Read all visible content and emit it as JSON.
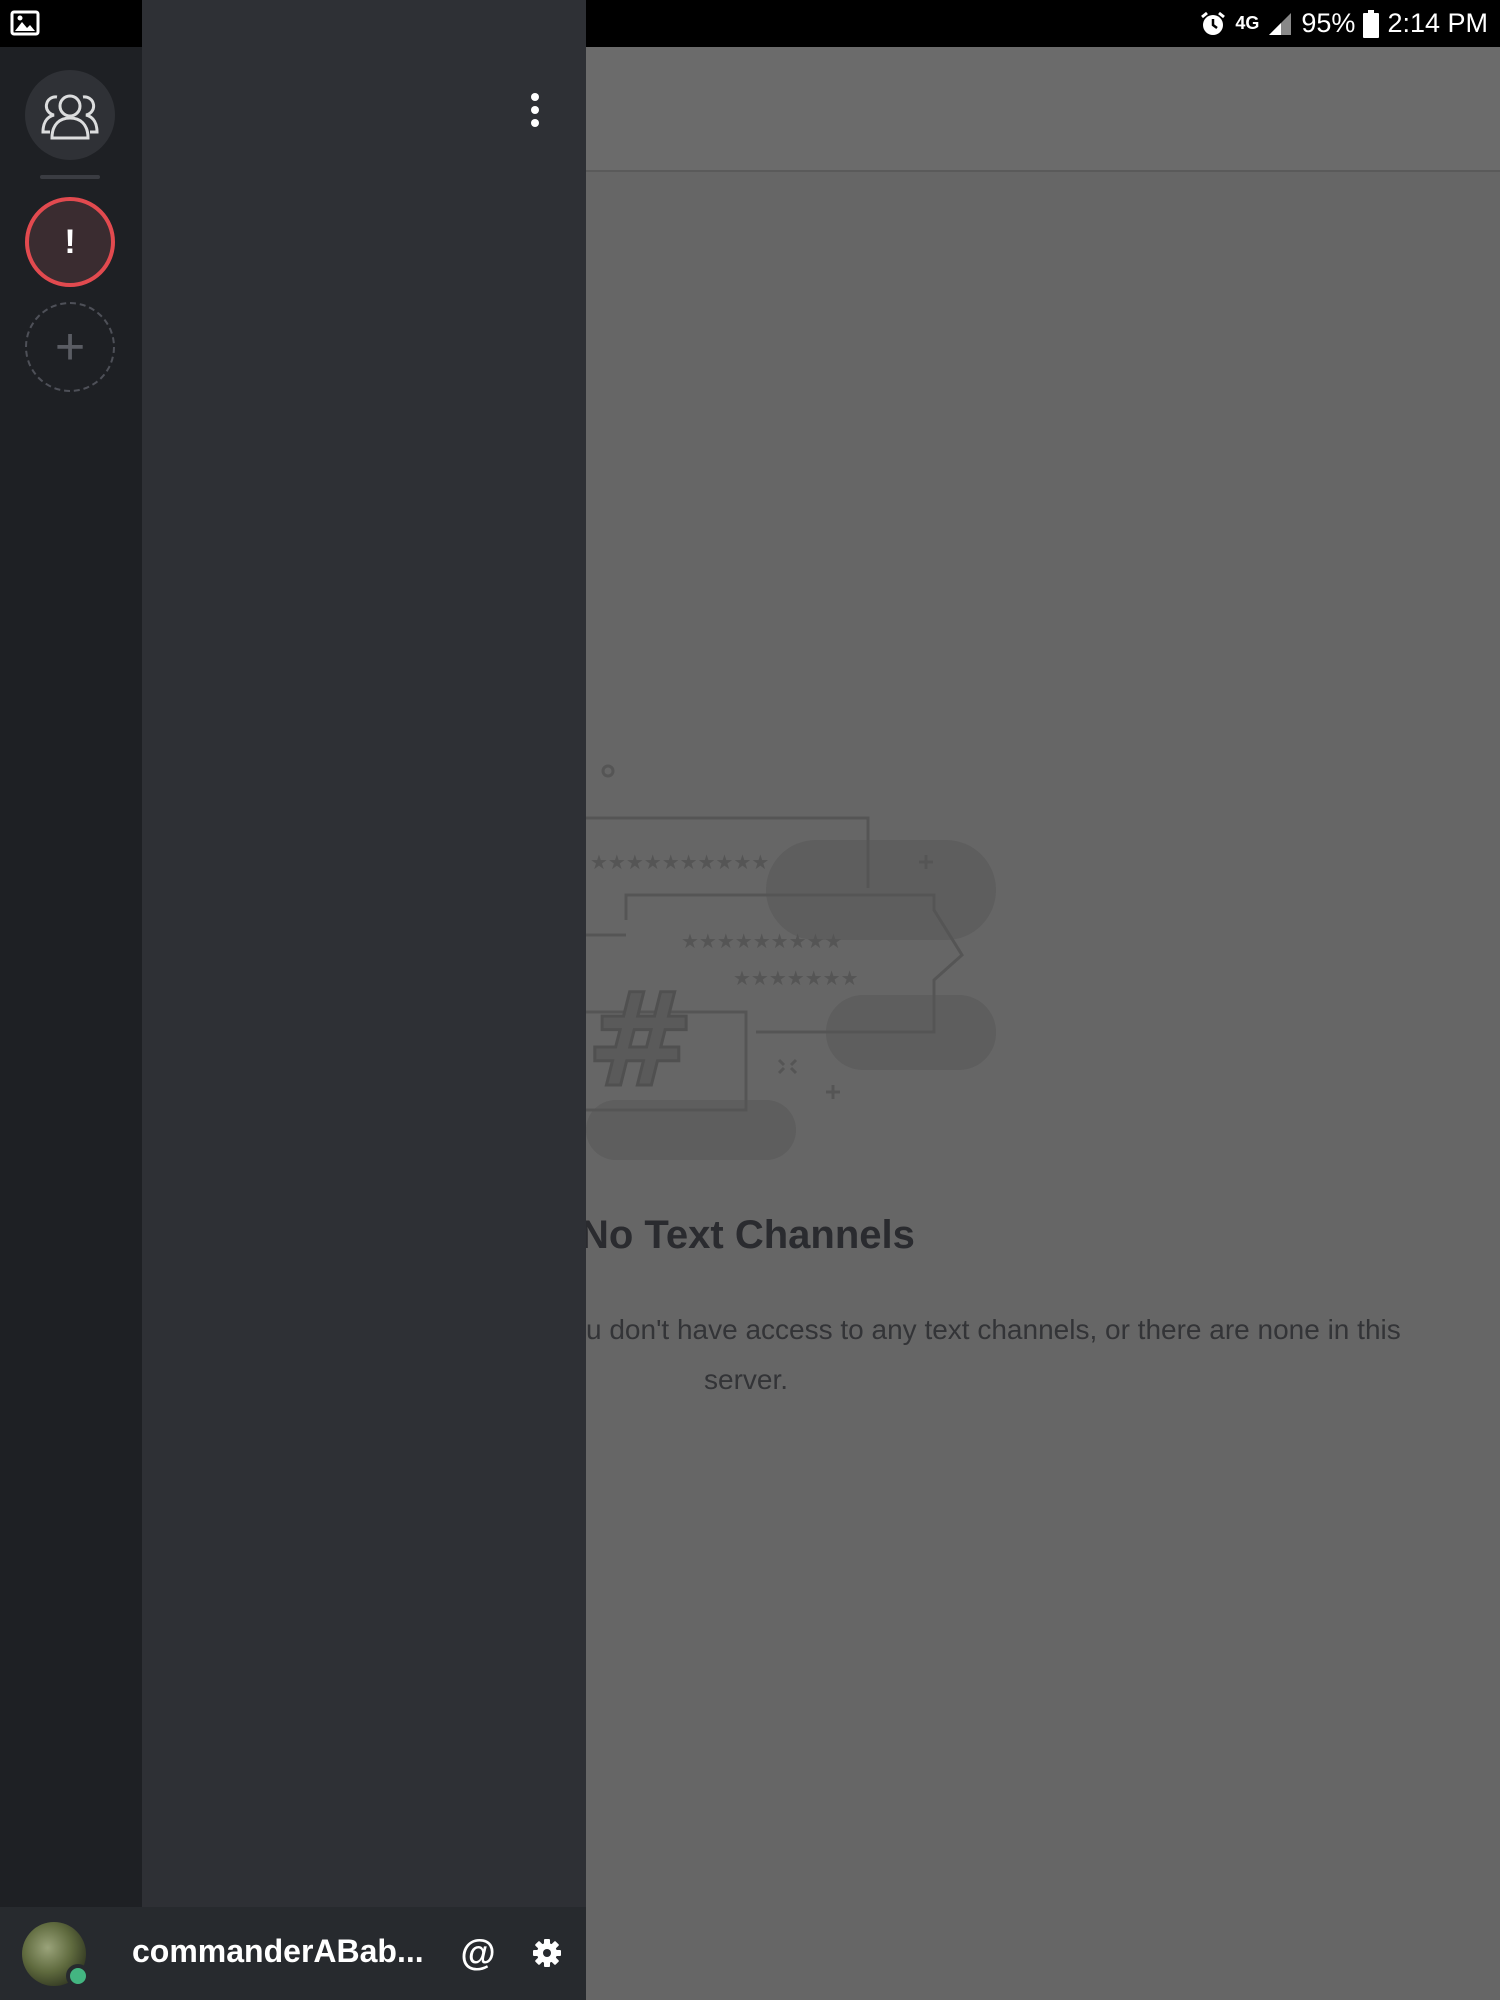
{
  "status_bar": {
    "network": "4G",
    "battery": "95%",
    "time": "2:14 PM"
  },
  "main": {
    "empty_title": "No Text Channels",
    "empty_desc_line1": "u don't have access to any text channels, or there are none in this",
    "empty_desc_line2": "server."
  },
  "guild_rail": {
    "alert_label": "!",
    "add_label": "+"
  },
  "user_bar": {
    "username": "commanderABab...",
    "mention_label": "@"
  },
  "colors": {
    "guild_rail_bg": "#1e2024",
    "channel_panel_bg": "#2e3035",
    "alert_ring": "#e24a4f",
    "online": "#43b581"
  }
}
